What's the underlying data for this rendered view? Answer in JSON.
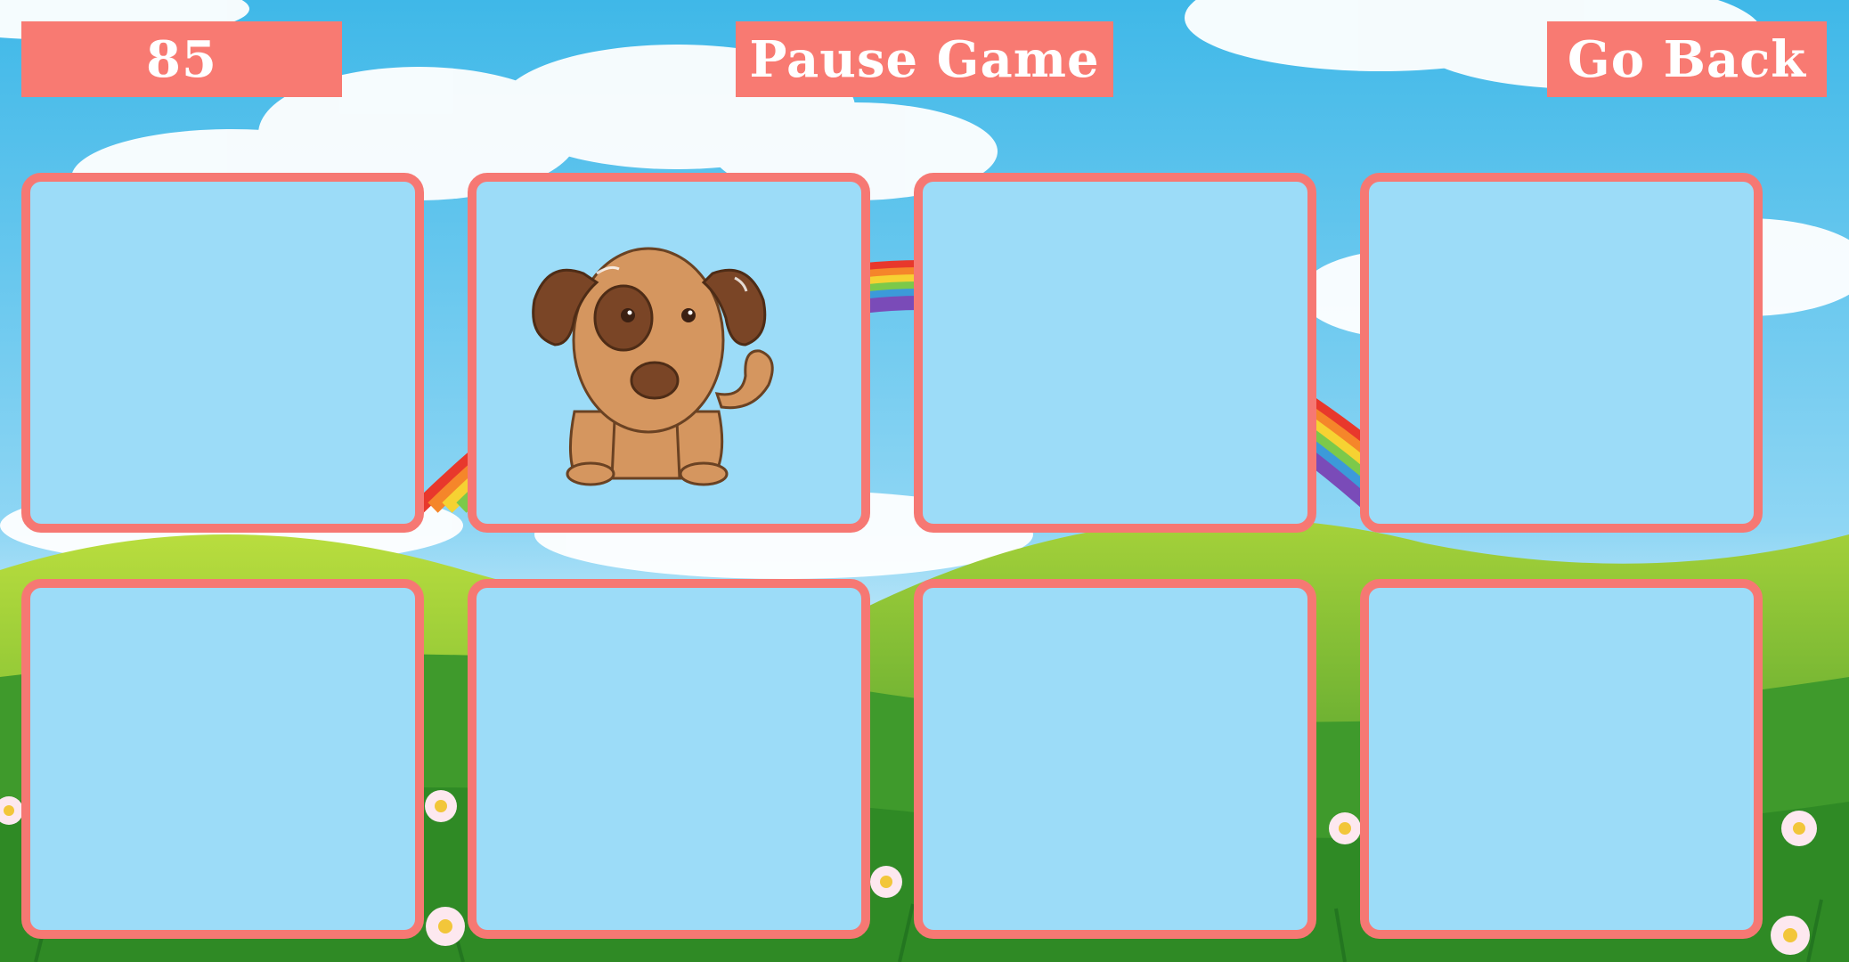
{
  "header": {
    "score": "85",
    "pause_label": "Pause Game",
    "back_label": "Go Back"
  },
  "board": {
    "cards": [
      {
        "state": "hidden"
      },
      {
        "state": "revealed",
        "icon": "dog-icon"
      },
      {
        "state": "hidden"
      },
      {
        "state": "hidden"
      },
      {
        "state": "hidden"
      },
      {
        "state": "hidden"
      },
      {
        "state": "hidden"
      },
      {
        "state": "hidden"
      }
    ]
  },
  "colors": {
    "button": "#f87a72",
    "card_face": "#9cdcf8",
    "card_border": "#f67873",
    "sky": "#46bdea"
  }
}
